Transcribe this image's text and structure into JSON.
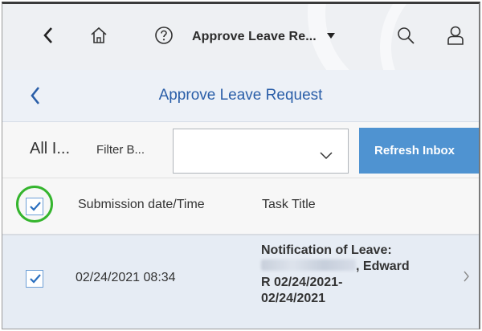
{
  "shell": {
    "title": "Approve Leave Re...",
    "icons": [
      "back-icon",
      "home-icon",
      "help-icon",
      "dropdown-caret-icon",
      "search-icon",
      "user-icon"
    ]
  },
  "page": {
    "title": "Approve Leave Request"
  },
  "filter": {
    "all_label": "All I...",
    "filter_label": "Filter B...",
    "select_value": "",
    "refresh_label": "Refresh Inbox"
  },
  "table": {
    "columns": [
      "Submission date/Time",
      "Task Title"
    ],
    "select_all_checked": true,
    "rows": [
      {
        "checked": true,
        "date": "02/24/2021 08:34",
        "title_line1": "Notification of Leave:",
        "title_line2_suffix": ", Edward",
        "title_line3": "R 02/24/2021-",
        "title_line4": "02/24/2021"
      }
    ]
  },
  "colors": {
    "accent": "#4f93d1",
    "title_blue": "#2a5ea8",
    "highlight_ring": "#35b52e",
    "row_selected_bg": "#e6ecf4"
  }
}
